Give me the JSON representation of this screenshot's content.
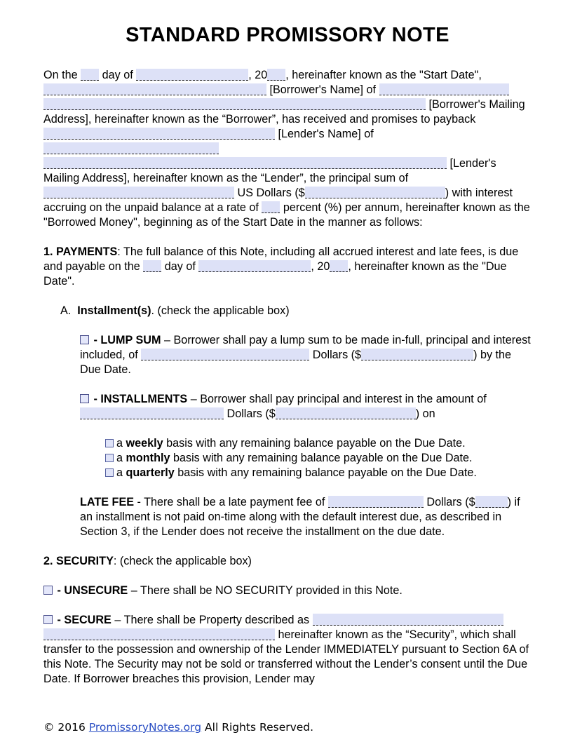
{
  "document": {
    "title": "STANDARD PROMISSORY NOTE"
  },
  "intro": {
    "t1": "On the",
    "t2": "day of",
    "t3": ", 20",
    "t4": ", hereinafter known as the \"Start Date\",",
    "t5": "[Borrower's Name] of",
    "t6": "[Borrower's Mailing Address], hereinafter known as the “Borrower”, has received and promises to payback",
    "t7": "[Lender's Name] of",
    "t8": "[Lender's Mailing Address], hereinafter known as the “Lender”, the principal sum of",
    "t9": "US Dollars ($",
    "t10": ") with interest accruing on the unpaid balance at a rate of",
    "t11": "percent (%) per annum, hereinafter known as the \"Borrowed Money\", beginning as of the Start Date in the manner as follows:"
  },
  "section1": {
    "number": "1.",
    "heading": "PAYMENTS",
    "t1": ": The full balance of this Note, including all accrued interest and late fees, is due and payable on the",
    "t2": "day of",
    "t3": ", 20",
    "t4": ", hereinafter known as the \"Due Date\".",
    "itemA": {
      "label": "A.",
      "heading": "Installment(s)",
      "suffix": ". (check the applicable box)"
    },
    "lump_sum": {
      "dash": "-",
      "heading": "LUMP SUM",
      "t1": "– Borrower shall pay a lump sum to be made in-full, principal and interest included, of",
      "t2": "Dollars ($",
      "t3": ") by the Due Date."
    },
    "installments": {
      "dash": "-",
      "heading": "INSTALLMENTS",
      "t1": "– Borrower shall pay principal and interest in the amount of",
      "t2": "Dollars ($",
      "t3": ") on"
    },
    "frequency": [
      {
        "prefix": "a",
        "term": "weekly",
        "suffix": "basis with any remaining balance payable on the Due Date."
      },
      {
        "prefix": "a",
        "term": "monthly",
        "suffix": "basis with any remaining balance payable on the Due Date."
      },
      {
        "prefix": "a",
        "term": "quarterly",
        "suffix": "basis with any remaining balance payable on the Due Date."
      }
    ],
    "late_fee": {
      "heading": "LATE FEE",
      "t1": "- There shall be a late payment fee of",
      "t2": "Dollars ($",
      "t3": ") if an installment is not paid on-time along with the default interest due, as described in Section 3, if the Lender does not receive the installment on the due date."
    }
  },
  "section2": {
    "number": "2.",
    "heading": "SECURITY",
    "suffix": ": (check the applicable box)",
    "unsecure": {
      "dash": "-",
      "heading": "UNSECURE",
      "text": "– There shall be NO SECURITY provided in this Note."
    },
    "secure": {
      "dash": "-",
      "heading": "SECURE",
      "t1": "– There shall be Property described as",
      "t2": "hereinafter known as the “Security”, which shall transfer to the possession and ownership of the Lender IMMEDIATELY pursuant to Section 6A of this Note. The Security may not be sold or transferred without the Lender’s consent until the Due Date. If Borrower breaches this provision, Lender may"
    }
  },
  "footer": {
    "copyright": "© 2016",
    "link": "PromissoryNotes.org",
    "rights": "All Rights Reserved."
  },
  "colors": {
    "field_fill": "#dde1f7",
    "checkbox_border": "#4a4f8c",
    "link": "#2b4fc4",
    "text": "#000000",
    "page_background": "#ffffff"
  }
}
